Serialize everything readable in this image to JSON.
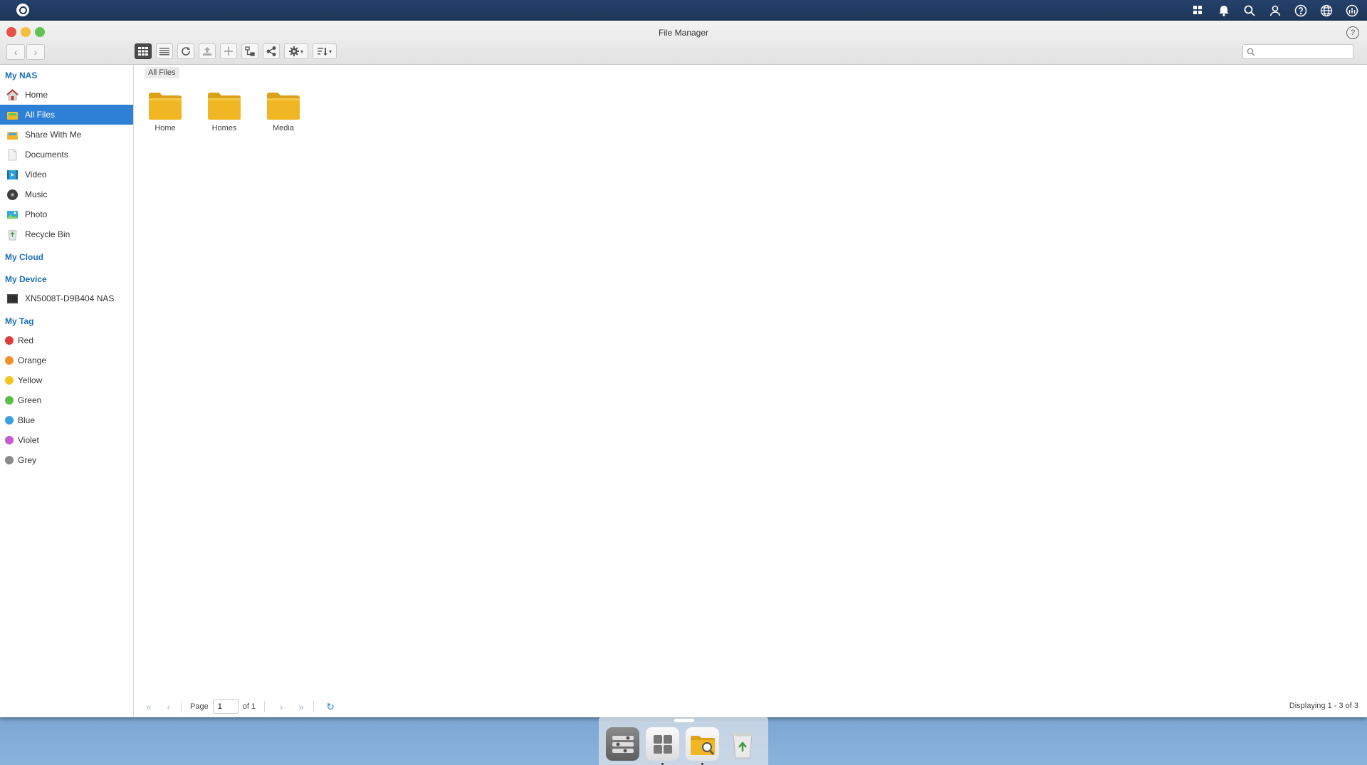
{
  "window": {
    "title": "File Manager",
    "help": "?"
  },
  "search": {
    "placeholder": ""
  },
  "breadcrumb": "All Files",
  "sidebar": {
    "sections": [
      {
        "heading": "My NAS",
        "items": [
          {
            "label": "Home",
            "icon": "home-icon"
          },
          {
            "label": "All Files",
            "icon": "all-files-icon",
            "selected": true
          },
          {
            "label": "Share With Me",
            "icon": "share-folder-icon"
          },
          {
            "label": "Documents",
            "icon": "documents-icon"
          },
          {
            "label": "Video",
            "icon": "video-icon"
          },
          {
            "label": "Music",
            "icon": "music-icon"
          },
          {
            "label": "Photo",
            "icon": "photo-icon"
          },
          {
            "label": "Recycle Bin",
            "icon": "recycle-bin-icon"
          }
        ]
      },
      {
        "heading": "My Cloud",
        "items": []
      },
      {
        "heading": "My Device",
        "items": [
          {
            "label": "XN5008T-D9B404 NAS",
            "icon": "nas-device-icon"
          }
        ]
      },
      {
        "heading": "My Tag",
        "tags": [
          {
            "label": "Red",
            "color": "#e03b3b"
          },
          {
            "label": "Orange",
            "color": "#f0922a"
          },
          {
            "label": "Yellow",
            "color": "#f2c521"
          },
          {
            "label": "Green",
            "color": "#5cbd47"
          },
          {
            "label": "Blue",
            "color": "#3aa0e0"
          },
          {
            "label": "Violet",
            "color": "#c65ad0"
          },
          {
            "label": "Grey",
            "color": "#8a8a8a"
          }
        ]
      }
    ]
  },
  "files": [
    {
      "name": "Home"
    },
    {
      "name": "Homes"
    },
    {
      "name": "Media"
    }
  ],
  "pager": {
    "page_label": "Page",
    "page_value": "1",
    "of_label": "of 1",
    "display": "Displaying 1 - 3 of 3"
  },
  "colors": {
    "accent": "#2e80d6",
    "folder": "#f0b623",
    "section_heading": "#1b6fba"
  }
}
